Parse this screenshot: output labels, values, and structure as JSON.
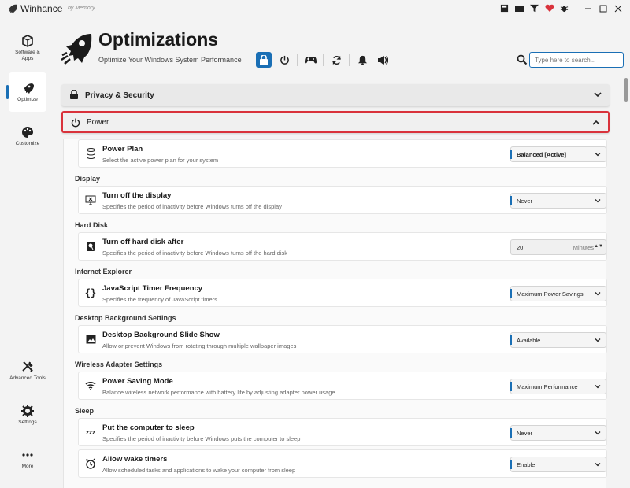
{
  "app": {
    "title": "Winhance",
    "byline": "by Memory"
  },
  "titlebar_icons": [
    "save-icon",
    "folder-icon",
    "filter-icon",
    "heart-icon",
    "bug-icon",
    "minimize-icon",
    "maximize-icon",
    "close-icon"
  ],
  "sidebar": {
    "items": [
      {
        "label": "Software & Apps",
        "icon": "cube-icon",
        "active": false
      },
      {
        "label": "Optimize",
        "icon": "rocket-icon",
        "active": true
      },
      {
        "label": "Customize",
        "icon": "palette-icon",
        "active": false
      },
      {
        "label": "Advanced Tools",
        "icon": "tools-icon",
        "active": false
      },
      {
        "label": "Settings",
        "icon": "gear-icon",
        "active": false
      },
      {
        "label": "More",
        "icon": "more-icon",
        "active": false
      }
    ]
  },
  "header": {
    "title": "Optimizations",
    "subtitle": "Optimize Your Windows System Performance",
    "category_icons": [
      "lock-icon",
      "power-icon",
      "gamepad-icon",
      "update-icon",
      "notification-icon",
      "sound-icon"
    ]
  },
  "search": {
    "placeholder": "Type here to search..."
  },
  "sections": [
    {
      "label": "Privacy & Security",
      "expanded": false
    },
    {
      "label": "Power",
      "expanded": true
    }
  ],
  "power": {
    "power_plan": {
      "title": "Power Plan",
      "desc": "Select the active power plan for your system",
      "value": "Balanced [Active]"
    },
    "groups": [
      {
        "label": "Display",
        "title": "Turn off the display",
        "desc": "Specifies the period of inactivity before Windows turns off the display",
        "value": "Never"
      },
      {
        "label": "Hard Disk",
        "title": "Turn off hard disk after",
        "desc": "Specifies the period of inactivity before Windows turns off the hard disk",
        "value": "20",
        "unit": "Minutes"
      },
      {
        "label": "Internet Explorer",
        "title": "JavaScript Timer Frequency",
        "desc": "Specifies the frequency of JavaScript timers",
        "value": "Maximum Power Savings"
      },
      {
        "label": "Desktop Background Settings",
        "title": "Desktop Background Slide Show",
        "desc": "Allow or prevent Windows from rotating through multiple wallpaper images",
        "value": "Available"
      },
      {
        "label": "Wireless Adapter Settings",
        "title": "Power Saving Mode",
        "desc": "Balance wireless network performance with battery life by adjusting adapter power usage",
        "value": "Maximum Performance"
      },
      {
        "label": "Sleep",
        "title": "Put the computer to sleep",
        "desc": "Specifies the period of inactivity before Windows puts the computer to sleep",
        "value": "Never"
      }
    ],
    "wake_timers": {
      "title": "Allow wake timers",
      "desc": "Allow scheduled tasks and applications to wake your computer from sleep",
      "value": "Enable"
    }
  },
  "colors": {
    "accent": "#1a6fb5",
    "expanded_border": "#d9323b",
    "heart": "#d9323b"
  }
}
